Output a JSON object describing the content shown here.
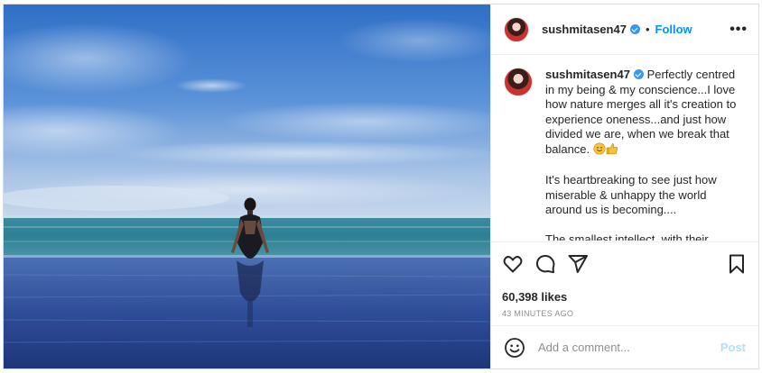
{
  "user": {
    "username": "sushmitasen47",
    "follow_label": "Follow",
    "separator": "•",
    "more_label": "•••"
  },
  "caption": {
    "username": "sushmitasen47",
    "paragraph_1": "Perfectly centred in my being & my conscience...I love how nature merges all it's creation to experience oneness...and just how divided we are, when we break that balance.",
    "paragraph_2": "It's heartbreaking to see just how miserable & unhappy the world around us is becoming....",
    "paragraph_3_partial": "The smallest intellect, with their"
  },
  "stats": {
    "likes": "60,398 likes",
    "time_ago": "43 MINUTES AGO"
  },
  "comment": {
    "placeholder": "Add a comment...",
    "post_label": "Post"
  },
  "icons": {
    "like": "heart-icon",
    "comment": "speech-bubble-icon",
    "share": "paper-plane-icon",
    "save": "bookmark-icon",
    "emoji": "smiley-icon",
    "verified": "verified-badge-icon"
  },
  "colors": {
    "accent": "#0095f6",
    "post_disabled": "#b2dffc",
    "muted": "#8e8e8e",
    "verified": "#3897f0"
  }
}
